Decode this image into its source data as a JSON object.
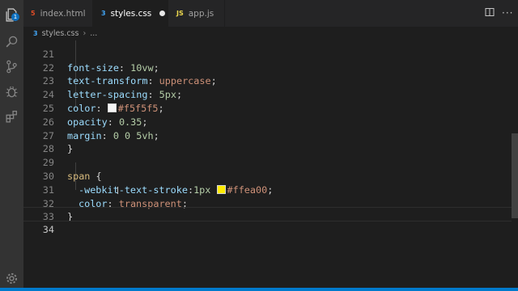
{
  "activity_bar": {
    "badge_count": "1",
    "icons": [
      "files-icon",
      "search-icon",
      "source-control-icon",
      "debug-icon",
      "extensions-icon",
      "manage-icon"
    ]
  },
  "tabs": [
    {
      "label": "index.html",
      "icon": "html-file-icon",
      "icon_glyph": "5",
      "icon_color": "#e44d26",
      "active": false
    },
    {
      "label": "styles.css",
      "icon": "css-file-icon",
      "icon_glyph": "3",
      "icon_color": "#42a5f5",
      "active": true,
      "modified": true
    },
    {
      "label": "app.js",
      "icon": "js-file-icon",
      "icon_glyph": "JS",
      "icon_color": "#f0db4f",
      "active": false
    }
  ],
  "breadcrumb": {
    "file": "styles.css",
    "rest": "..."
  },
  "editor": {
    "lines": [
      {
        "n": "21",
        "text": "  font-size: 10vw;"
      },
      {
        "n": "22",
        "text": "  text-transform: uppercase;"
      },
      {
        "n": "23",
        "text": "  letter-spacing: 5px;"
      },
      {
        "n": "24",
        "text": "  color: #f5f5f5;"
      },
      {
        "n": "25",
        "text": "  opacity: 0.35;"
      },
      {
        "n": "26",
        "text": "  margin: 0 0 5vh;"
      },
      {
        "n": "27",
        "text": "}"
      },
      {
        "n": "28",
        "text": ""
      },
      {
        "n": "29",
        "text": "span {"
      },
      {
        "n": "30",
        "text": "  -webkit-text-stroke:1px #ffea00;"
      },
      {
        "n": "31",
        "text": "  color: transparent;"
      },
      {
        "n": "32",
        "text": "}"
      },
      {
        "n": "33",
        "text": ""
      },
      {
        "n": "34",
        "text": ""
      }
    ],
    "current_line": "34",
    "colors": {
      "swatch_1": "#f5f5f5",
      "swatch_2": "#ffea00"
    }
  },
  "tokens": {
    "l21": {
      "prop": "font-size",
      "num": "10",
      "unit": "vw"
    },
    "l22": {
      "prop": "text-transform",
      "val": "uppercase"
    },
    "l23": {
      "prop": "letter-spacing",
      "num": "5",
      "unit": "px"
    },
    "l24": {
      "prop": "color",
      "val": "#f5f5f5"
    },
    "l25": {
      "prop": "opacity",
      "num": "0.35"
    },
    "l26": {
      "prop": "margin",
      "num": "0 0 5",
      "unit": "vh"
    },
    "l29": {
      "sel": "span"
    },
    "l30": {
      "prop": "-webkit-text-stroke",
      "num": "1",
      "unit": "px",
      "val": "#ffea00"
    },
    "l31": {
      "prop": "color",
      "val": "transparent"
    }
  }
}
